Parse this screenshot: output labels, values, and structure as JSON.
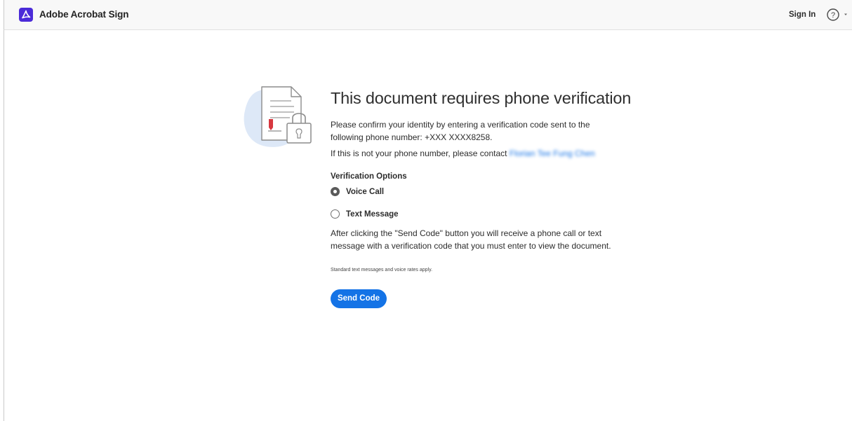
{
  "header": {
    "app_title": "Adobe Acrobat Sign",
    "sign_in_label": "Sign In",
    "help_glyph": "?",
    "logo_icon": "acrobat-logo-icon",
    "brand_color": "#4b2bd8"
  },
  "main": {
    "title": "This document requires phone verification",
    "confirm_text": "Please confirm your identity by entering a verification code sent to the following phone number: +XXX XXXX8258.",
    "contact_prefix": "If this is not your phone number, please contact ",
    "contact_name": "Florian Tee Fung Chen",
    "options_heading": "Verification Options",
    "options": [
      {
        "label": "Voice Call",
        "selected": true
      },
      {
        "label": "Text Message",
        "selected": false
      }
    ],
    "instructions": "After clicking the \"Send Code\" button you will receive a phone call or text message with a verification code that you must enter to view the document.",
    "rates_note": "Standard text messages and voice rates apply.",
    "send_button_label": "Send Code",
    "accent_color": "#1473e6"
  }
}
